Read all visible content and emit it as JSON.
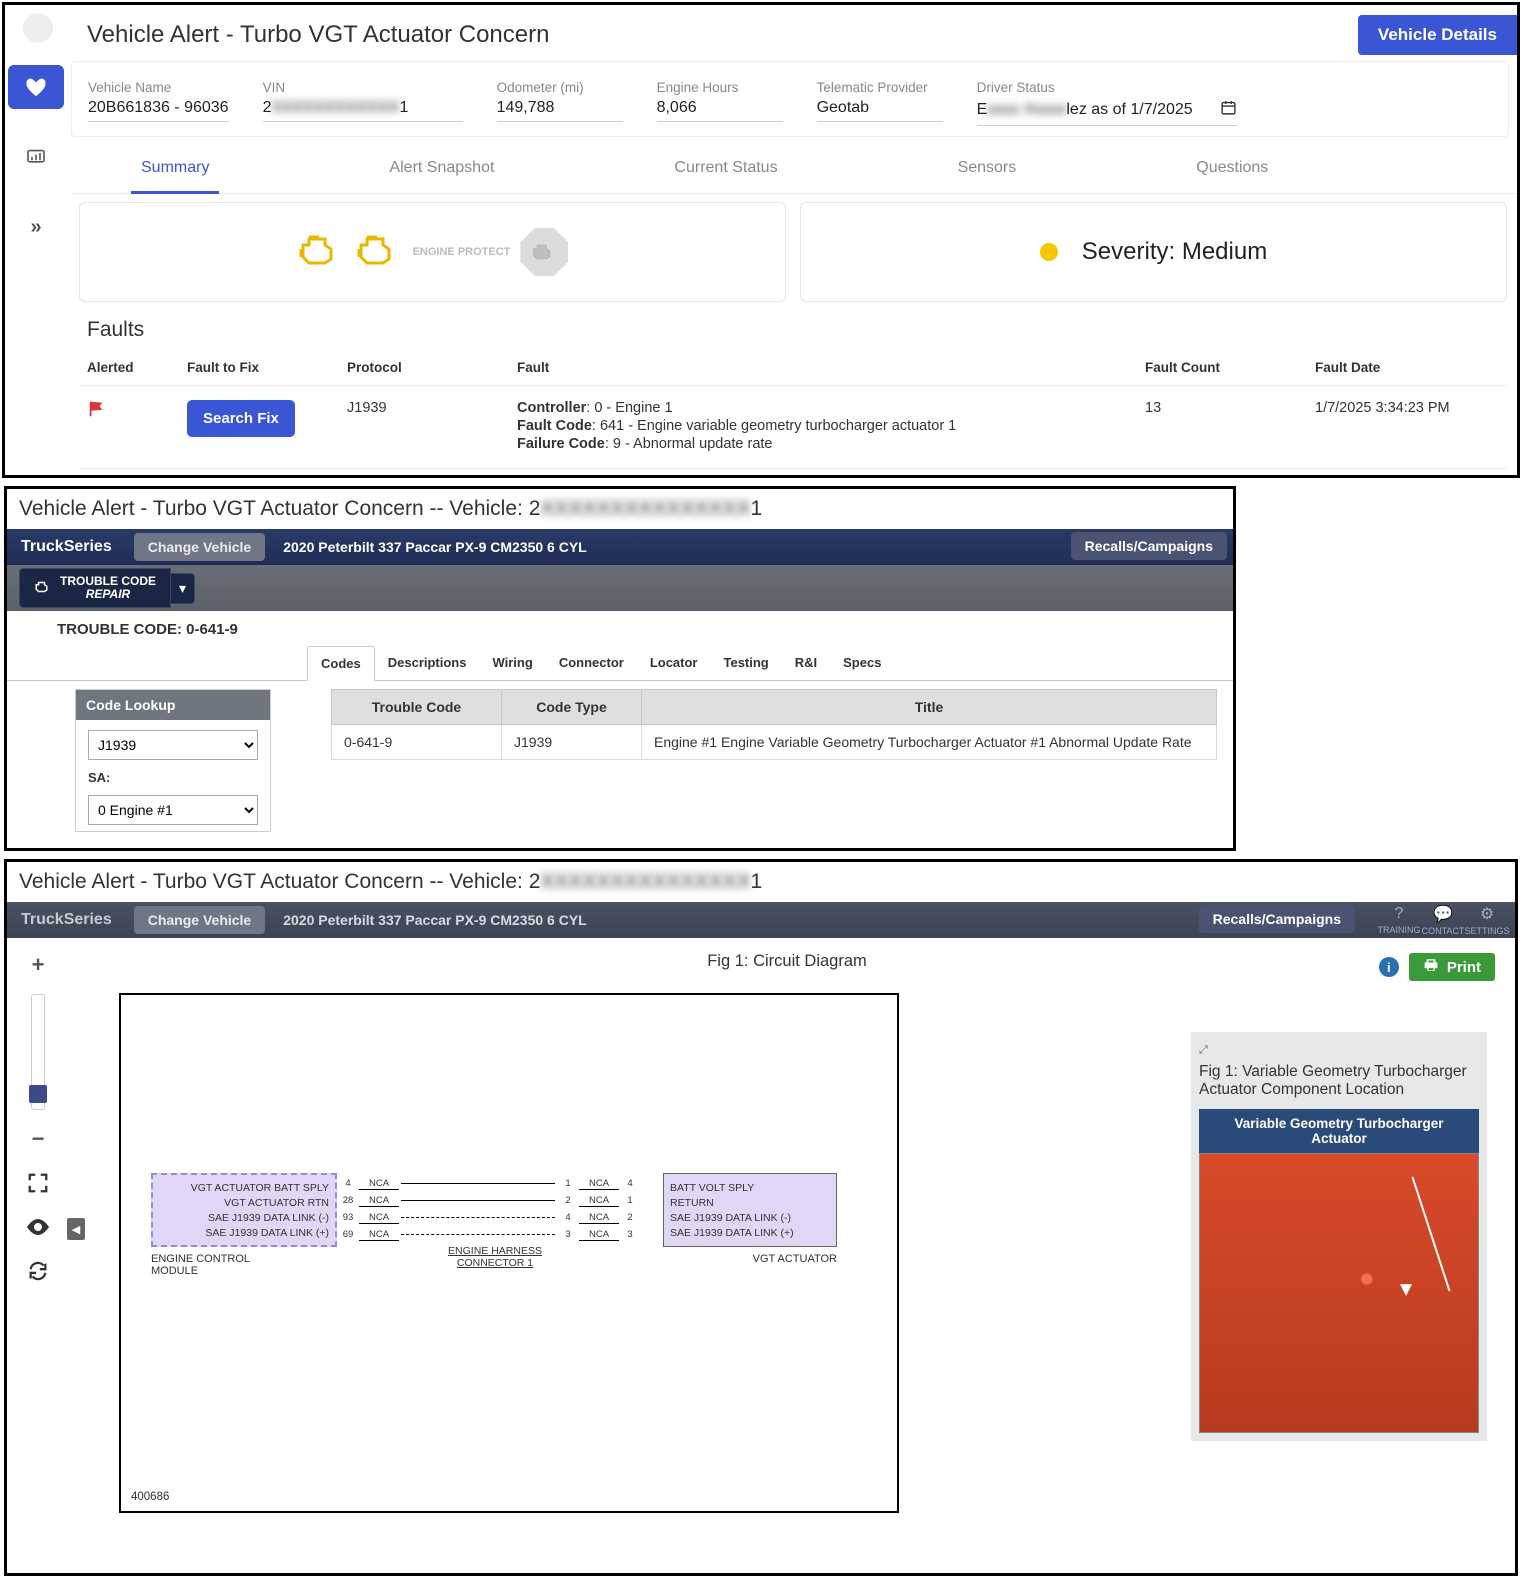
{
  "panel1": {
    "title": "Vehicle Alert - Turbo VGT Actuator Concern",
    "details_btn": "Vehicle Details",
    "fields": {
      "name_lbl": "Vehicle Name",
      "name_val": "20B661836 - 96036",
      "vin_lbl": "VIN",
      "vin_prefix": "2",
      "vin_hidden": "XXXXXXXXXXXX",
      "vin_suffix": "1",
      "odo_lbl": "Odometer (mi)",
      "odo_val": "149,788",
      "eng_lbl": "Engine Hours",
      "eng_val": "8,066",
      "tel_lbl": "Telematic Provider",
      "tel_val": "Geotab",
      "drv_lbl": "Driver Status",
      "drv_prefix": "E",
      "drv_hidden": "xxxx Xxxxx",
      "drv_suffix": "lez as of 1/7/2025"
    },
    "tabs": [
      "Summary",
      "Alert Snapshot",
      "Current Status",
      "Sensors",
      "Questions"
    ],
    "active_tab": 0,
    "engine_protect": "ENGINE PROTECT",
    "severity": "Severity: Medium",
    "faults_header": "Faults",
    "faults_cols": [
      "Alerted",
      "Fault to Fix",
      "Protocol",
      "Fault",
      "Fault Count",
      "Fault Date"
    ],
    "search_fix": "Search Fix",
    "fault_row": {
      "protocol": "J1939",
      "controller_lbl": "Controller",
      "controller_val": "0 - Engine 1",
      "fault_code_lbl": "Fault Code",
      "fault_code_val": "641 - Engine variable geometry turbocharger actuator 1",
      "failure_code_lbl": "Failure Code",
      "failure_code_val": "9 - Abnormal update rate",
      "count": "13",
      "date": "1/7/2025 3:34:23 PM"
    }
  },
  "panel2": {
    "header_prefix": "Vehicle Alert - Turbo VGT Actuator Concern -- Vehicle: 2",
    "header_hidden": "XXXXXXXXXXXXXXX",
    "header_suffix": "1",
    "ts_brand": "TruckSeries",
    "change_vehicle": "Change Vehicle",
    "vehicle_desc": "2020 Peterbilt 337 Paccar PX-9 CM2350 6 CYL",
    "recalls": "Recalls/Campaigns",
    "repair_btn_top": "TROUBLE CODE",
    "repair_btn_bottom": "REPAIR",
    "tc_label": "TROUBLE CODE: 0-641-9",
    "diag_tabs": [
      "Codes",
      "Descriptions",
      "Wiring",
      "Connector",
      "Locator",
      "Testing",
      "R&I",
      "Specs"
    ],
    "active_diag_tab": 0,
    "code_lookup_header": "Code Lookup",
    "protocol_select": "J1939",
    "sa_label": "SA:",
    "sa_select": "0 Engine #1",
    "tc_cols": [
      "Trouble Code",
      "Code Type",
      "Title"
    ],
    "tc_row": {
      "code": "0-641-9",
      "type": "J1939",
      "title": "Engine #1 Engine Variable Geometry Turbocharger Actuator #1 Abnormal Update Rate"
    }
  },
  "panel3": {
    "fig_title": "Fig 1: Circuit Diagram",
    "print": "Print",
    "ecm_signals": [
      "VGT ACTUATOR BATT SPLY",
      "VGT ACTUATOR RTN",
      "SAE J1939 DATA LINK (-)",
      "SAE J1939 DATA LINK (+)"
    ],
    "vgt_signals": [
      "BATT VOLT SPLY",
      "RETURN",
      "SAE J1939 DATA LINK (-)",
      "SAE J1939 DATA LINK (+)"
    ],
    "wires": [
      {
        "pl": "4",
        "nca1": "NCA",
        "pl2": "1",
        "nca2": "NCA",
        "pr": "4"
      },
      {
        "pl": "28",
        "nca1": "NCA",
        "pl2": "2",
        "nca2": "NCA",
        "pr": "1"
      },
      {
        "pl": "93",
        "nca1": "NCA",
        "pl2": "4",
        "nca2": "NCA",
        "pr": "2"
      },
      {
        "pl": "69",
        "nca1": "NCA",
        "pl2": "3",
        "nca2": "NCA",
        "pr": "3"
      }
    ],
    "ecm_label": "ENGINE CONTROL MODULE",
    "vgt_label": "VGT ACTUATOR",
    "harness_label": "ENGINE HARNESS CONNECTOR 1",
    "diagram_num": "400686",
    "ref_caption": "Fig 1: Variable Geometry Turbocharger Actuator Component Location",
    "ref_img_header": "Variable Geometry Turbocharger Actuator",
    "ts_right_icons": [
      "TRAINING",
      "CONTACT",
      "SETTINGS"
    ]
  }
}
